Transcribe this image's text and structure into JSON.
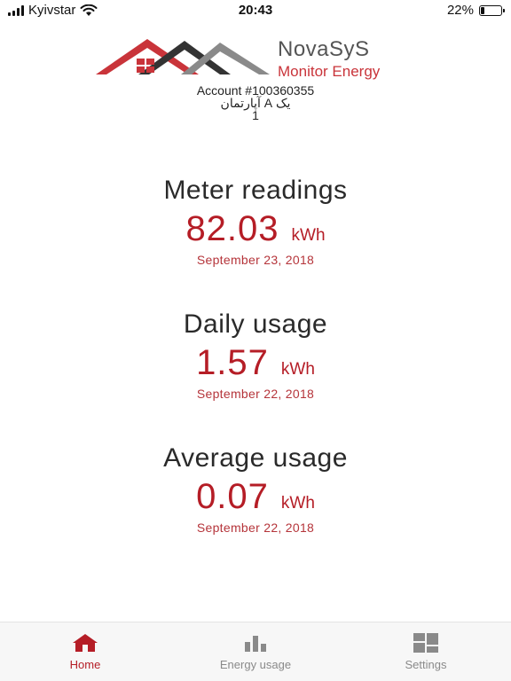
{
  "status_bar": {
    "carrier": "Kyivstar",
    "time": "20:43",
    "battery_percent": "22%",
    "battery_level": 0.22
  },
  "logo": {
    "title": "NovaSyS",
    "subtitle": "Monitor Energy"
  },
  "account": {
    "number": "Account #100360355",
    "name": "یک A آپارتمان",
    "index": "1"
  },
  "metrics": [
    {
      "title": "Meter readings",
      "value": "82.03",
      "unit": "kWh",
      "date": "September 23, 2018"
    },
    {
      "title": "Daily usage",
      "value": "1.57",
      "unit": "kWh",
      "date": "September 22, 2018"
    },
    {
      "title": "Average usage",
      "value": "0.07",
      "unit": "kWh",
      "date": "September 22, 2018"
    }
  ],
  "tabs": [
    {
      "label": "Home",
      "icon": "home-icon",
      "active": true
    },
    {
      "label": "Energy usage",
      "icon": "bar-chart-icon",
      "active": false
    },
    {
      "label": "Settings",
      "icon": "grid-icon",
      "active": false
    }
  ],
  "colors": {
    "accent": "#b51d26",
    "inactive": "#8a8a8a",
    "logo_red": "#c9343a",
    "logo_dark": "#3a3a3a"
  }
}
